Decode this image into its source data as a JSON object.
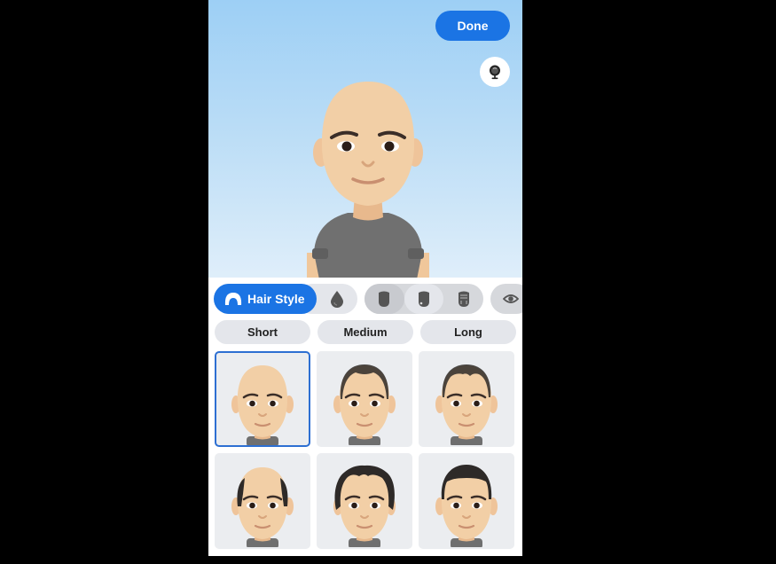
{
  "header": {
    "done_label": "Done",
    "mirror_icon": "mirror-icon"
  },
  "colors": {
    "accent": "#1b74e4",
    "selected_border": "#2d6fd2",
    "tile_bg": "#ebedf0",
    "chip_bg": "#e4e6eb",
    "skin": "#f2cfa6",
    "shirt": "#6f6f6f",
    "hair": "#2e2a28"
  },
  "categories": [
    {
      "label": "Hair Style",
      "icon": "hair-icon",
      "active": true
    },
    {
      "label": "",
      "icon": "hair-color-drop-icon",
      "active": false
    },
    {
      "label": "",
      "icon": "face-shape-icon",
      "active": false
    },
    {
      "label": "",
      "icon": "face-complexion-icon",
      "active": false
    },
    {
      "label": "",
      "icon": "face-lines-icon",
      "active": false
    },
    {
      "label": "",
      "icon": "eye-icon",
      "active": false
    }
  ],
  "subcategories": [
    {
      "label": "Short"
    },
    {
      "label": "Medium"
    },
    {
      "label": "Long"
    }
  ],
  "hairstyles": [
    {
      "name": "bald",
      "selected": true
    },
    {
      "name": "buzz-receding",
      "selected": false
    },
    {
      "name": "buzz-short",
      "selected": false
    },
    {
      "name": "balding-sides",
      "selected": false
    },
    {
      "name": "thinning-wavy",
      "selected": false
    },
    {
      "name": "crew-cut",
      "selected": false
    }
  ]
}
